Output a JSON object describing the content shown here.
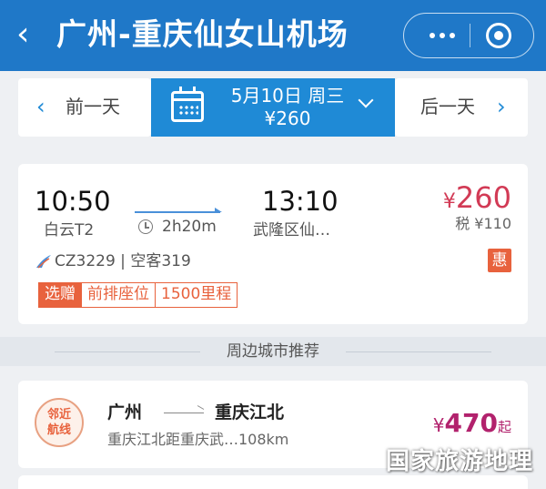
{
  "header": {
    "back_glyph": "‹",
    "title": "广州-重庆仙女山机场",
    "more_icon": "more-icon",
    "close_icon": "close-icon"
  },
  "date_bar": {
    "prev_label": "前一天",
    "next_label": "后一天",
    "date": "5月10日 周三",
    "price": "¥260",
    "accent": "#1f8ad6"
  },
  "flight": {
    "departure_time": "10:50",
    "departure_airport": "白云T2",
    "duration": "2h20m",
    "arrival_time": "13:10",
    "arrival_airport": "武隆区仙…",
    "currency": "¥",
    "price": "260",
    "tax": "税 ¥110",
    "flight_info": "CZ3229 | 空客319",
    "promo_badge": "惠",
    "tags": [
      "选赠",
      "前排座位",
      "1500里程"
    ]
  },
  "section": {
    "title": "周边城市推荐"
  },
  "nearby": {
    "badge_line1": "邻近",
    "badge_line2": "航线",
    "from": "广州",
    "to": "重庆江北",
    "description": "重庆江北距重庆武…108km",
    "currency": "¥",
    "price": "470",
    "suffix": "起"
  },
  "watermark": "国家旅游地理",
  "colors": {
    "header_bg": "#1f78c8",
    "price_red": "#d23a55",
    "promo_orange": "#e8623d",
    "nearby_price": "#b2226d"
  }
}
